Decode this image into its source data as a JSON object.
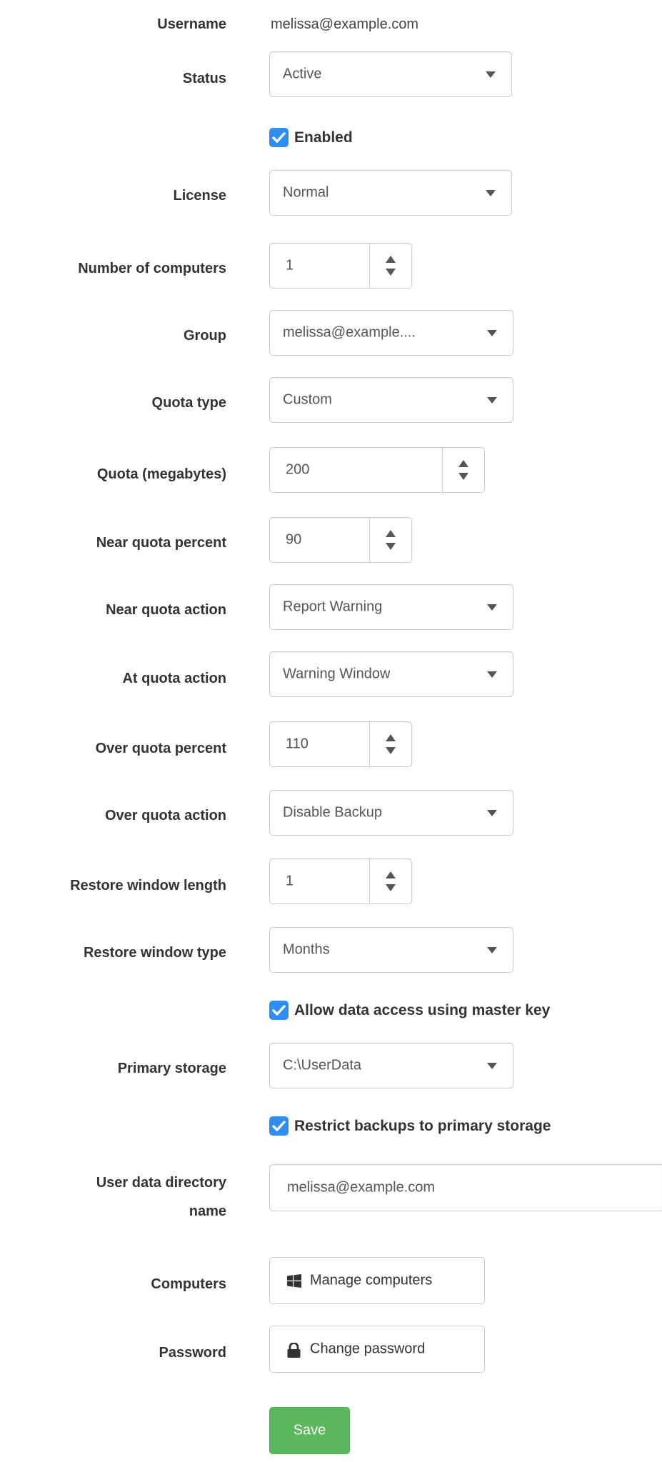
{
  "username": {
    "label": "Username",
    "value": "melissa@example.com"
  },
  "status": {
    "label": "Status",
    "value": "Active"
  },
  "enabled": {
    "label": "Enabled",
    "checked": true
  },
  "license": {
    "label": "License",
    "value": "Normal"
  },
  "computers_count": {
    "label": "Number of computers",
    "value": "1"
  },
  "group": {
    "label": "Group",
    "value": "melissa@example...."
  },
  "quota_type": {
    "label": "Quota type",
    "value": "Custom"
  },
  "quota_mb": {
    "label": "Quota (megabytes)",
    "value": "200"
  },
  "near_quota_percent": {
    "label": "Near quota percent",
    "value": "90"
  },
  "near_quota_action": {
    "label": "Near quota action",
    "value": "Report Warning"
  },
  "at_quota_action": {
    "label": "At quota action",
    "value": "Warning Window"
  },
  "over_quota_percent": {
    "label": "Over quota percent",
    "value": "110"
  },
  "over_quota_action": {
    "label": "Over quota action",
    "value": "Disable Backup"
  },
  "restore_window_length": {
    "label": "Restore window length",
    "value": "1"
  },
  "restore_window_type": {
    "label": "Restore window type",
    "value": "Months"
  },
  "master_key_access": {
    "label": "Allow data access using master key",
    "checked": true
  },
  "primary_storage": {
    "label": "Primary storage",
    "value": "C:\\UserData"
  },
  "restrict_primary": {
    "label": "Restrict backups to primary storage",
    "checked": true
  },
  "user_data_dir": {
    "label_line1": "User data directory",
    "label_line2": "name",
    "value": "melissa@example.com"
  },
  "computers": {
    "label": "Computers",
    "button": "Manage computers",
    "icon": "windows-icon"
  },
  "password": {
    "label": "Password",
    "button": "Change password",
    "icon": "lock-icon"
  },
  "save": {
    "label": "Save"
  },
  "colors": {
    "checkbox": "#2d8ef6",
    "save_button": "#5cb85c",
    "label_text": "#333333",
    "border": "#cccccc"
  }
}
